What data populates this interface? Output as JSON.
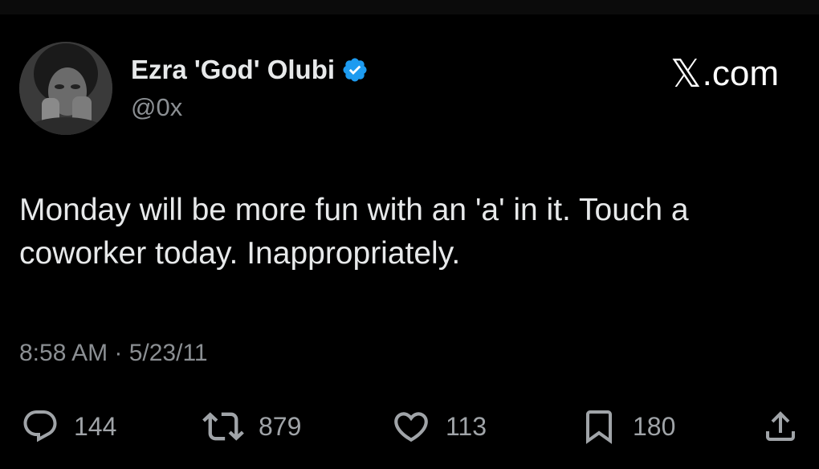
{
  "tweet": {
    "author": {
      "display_name": "Ezra 'God' Olubi",
      "handle": "@0x",
      "verified": true
    },
    "brand": {
      "x_glyph": "𝕏",
      "suffix": ".com"
    },
    "text": "Monday will be more fun with an 'a' in it. Touch a coworker today. Inappropriately.",
    "timestamp": "8:58 AM · 5/23/11",
    "stats": {
      "replies": "144",
      "reposts": "879",
      "likes": "113",
      "bookmarks": "180"
    }
  },
  "colors": {
    "background": "#000000",
    "primary_text": "#e7e9ea",
    "secondary_text": "#8b8f93",
    "verified_blue": "#1d9bf0"
  },
  "icons": {
    "reply": "reply-icon",
    "repost": "repost-icon",
    "like": "heart-icon",
    "bookmark": "bookmark-icon",
    "share": "share-icon",
    "verified": "verified-badge-icon"
  }
}
